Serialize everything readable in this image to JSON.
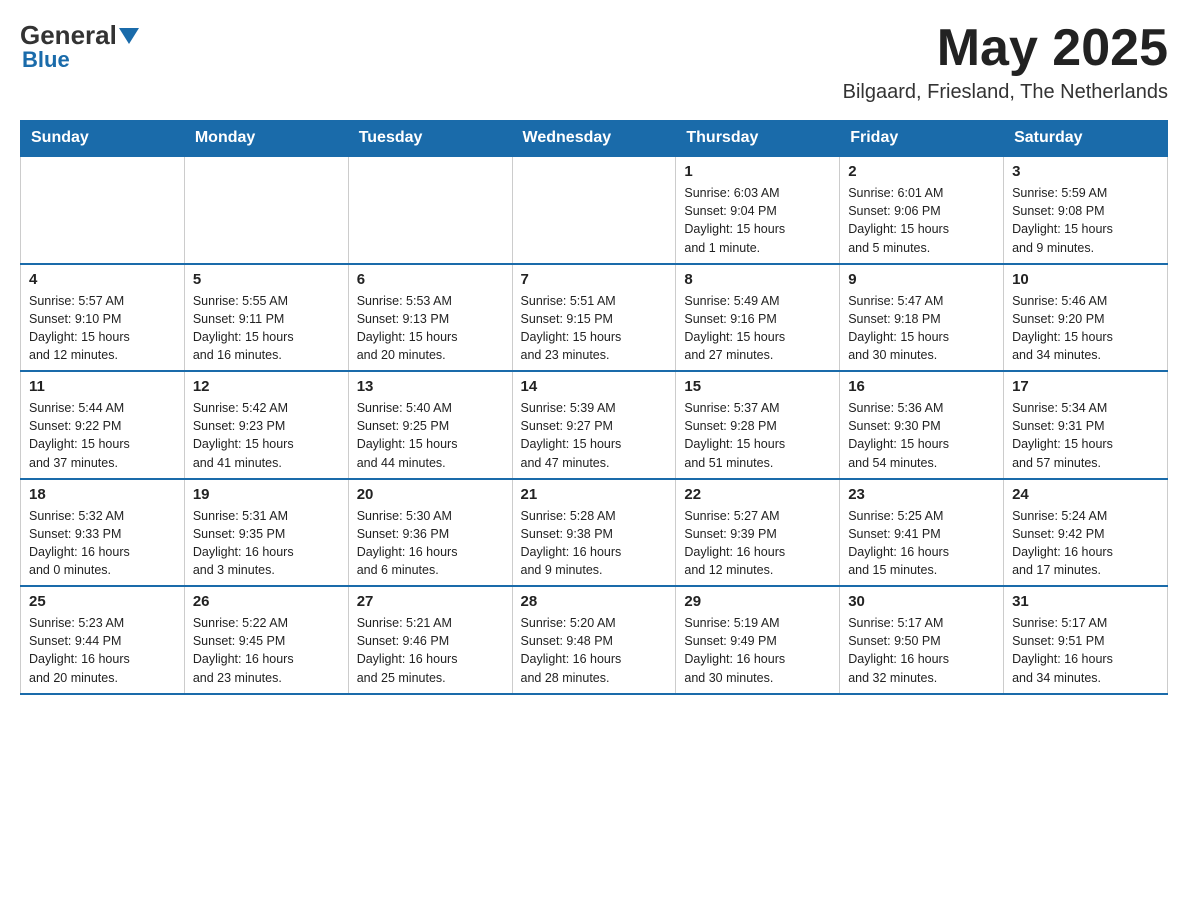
{
  "header": {
    "logo_general": "General",
    "logo_blue": "Blue",
    "month_title": "May 2025",
    "location": "Bilgaard, Friesland, The Netherlands"
  },
  "weekdays": [
    "Sunday",
    "Monday",
    "Tuesday",
    "Wednesday",
    "Thursday",
    "Friday",
    "Saturday"
  ],
  "weeks": [
    [
      {
        "day": "",
        "info": ""
      },
      {
        "day": "",
        "info": ""
      },
      {
        "day": "",
        "info": ""
      },
      {
        "day": "",
        "info": ""
      },
      {
        "day": "1",
        "info": "Sunrise: 6:03 AM\nSunset: 9:04 PM\nDaylight: 15 hours\nand 1 minute."
      },
      {
        "day": "2",
        "info": "Sunrise: 6:01 AM\nSunset: 9:06 PM\nDaylight: 15 hours\nand 5 minutes."
      },
      {
        "day": "3",
        "info": "Sunrise: 5:59 AM\nSunset: 9:08 PM\nDaylight: 15 hours\nand 9 minutes."
      }
    ],
    [
      {
        "day": "4",
        "info": "Sunrise: 5:57 AM\nSunset: 9:10 PM\nDaylight: 15 hours\nand 12 minutes."
      },
      {
        "day": "5",
        "info": "Sunrise: 5:55 AM\nSunset: 9:11 PM\nDaylight: 15 hours\nand 16 minutes."
      },
      {
        "day": "6",
        "info": "Sunrise: 5:53 AM\nSunset: 9:13 PM\nDaylight: 15 hours\nand 20 minutes."
      },
      {
        "day": "7",
        "info": "Sunrise: 5:51 AM\nSunset: 9:15 PM\nDaylight: 15 hours\nand 23 minutes."
      },
      {
        "day": "8",
        "info": "Sunrise: 5:49 AM\nSunset: 9:16 PM\nDaylight: 15 hours\nand 27 minutes."
      },
      {
        "day": "9",
        "info": "Sunrise: 5:47 AM\nSunset: 9:18 PM\nDaylight: 15 hours\nand 30 minutes."
      },
      {
        "day": "10",
        "info": "Sunrise: 5:46 AM\nSunset: 9:20 PM\nDaylight: 15 hours\nand 34 minutes."
      }
    ],
    [
      {
        "day": "11",
        "info": "Sunrise: 5:44 AM\nSunset: 9:22 PM\nDaylight: 15 hours\nand 37 minutes."
      },
      {
        "day": "12",
        "info": "Sunrise: 5:42 AM\nSunset: 9:23 PM\nDaylight: 15 hours\nand 41 minutes."
      },
      {
        "day": "13",
        "info": "Sunrise: 5:40 AM\nSunset: 9:25 PM\nDaylight: 15 hours\nand 44 minutes."
      },
      {
        "day": "14",
        "info": "Sunrise: 5:39 AM\nSunset: 9:27 PM\nDaylight: 15 hours\nand 47 minutes."
      },
      {
        "day": "15",
        "info": "Sunrise: 5:37 AM\nSunset: 9:28 PM\nDaylight: 15 hours\nand 51 minutes."
      },
      {
        "day": "16",
        "info": "Sunrise: 5:36 AM\nSunset: 9:30 PM\nDaylight: 15 hours\nand 54 minutes."
      },
      {
        "day": "17",
        "info": "Sunrise: 5:34 AM\nSunset: 9:31 PM\nDaylight: 15 hours\nand 57 minutes."
      }
    ],
    [
      {
        "day": "18",
        "info": "Sunrise: 5:32 AM\nSunset: 9:33 PM\nDaylight: 16 hours\nand 0 minutes."
      },
      {
        "day": "19",
        "info": "Sunrise: 5:31 AM\nSunset: 9:35 PM\nDaylight: 16 hours\nand 3 minutes."
      },
      {
        "day": "20",
        "info": "Sunrise: 5:30 AM\nSunset: 9:36 PM\nDaylight: 16 hours\nand 6 minutes."
      },
      {
        "day": "21",
        "info": "Sunrise: 5:28 AM\nSunset: 9:38 PM\nDaylight: 16 hours\nand 9 minutes."
      },
      {
        "day": "22",
        "info": "Sunrise: 5:27 AM\nSunset: 9:39 PM\nDaylight: 16 hours\nand 12 minutes."
      },
      {
        "day": "23",
        "info": "Sunrise: 5:25 AM\nSunset: 9:41 PM\nDaylight: 16 hours\nand 15 minutes."
      },
      {
        "day": "24",
        "info": "Sunrise: 5:24 AM\nSunset: 9:42 PM\nDaylight: 16 hours\nand 17 minutes."
      }
    ],
    [
      {
        "day": "25",
        "info": "Sunrise: 5:23 AM\nSunset: 9:44 PM\nDaylight: 16 hours\nand 20 minutes."
      },
      {
        "day": "26",
        "info": "Sunrise: 5:22 AM\nSunset: 9:45 PM\nDaylight: 16 hours\nand 23 minutes."
      },
      {
        "day": "27",
        "info": "Sunrise: 5:21 AM\nSunset: 9:46 PM\nDaylight: 16 hours\nand 25 minutes."
      },
      {
        "day": "28",
        "info": "Sunrise: 5:20 AM\nSunset: 9:48 PM\nDaylight: 16 hours\nand 28 minutes."
      },
      {
        "day": "29",
        "info": "Sunrise: 5:19 AM\nSunset: 9:49 PM\nDaylight: 16 hours\nand 30 minutes."
      },
      {
        "day": "30",
        "info": "Sunrise: 5:17 AM\nSunset: 9:50 PM\nDaylight: 16 hours\nand 32 minutes."
      },
      {
        "day": "31",
        "info": "Sunrise: 5:17 AM\nSunset: 9:51 PM\nDaylight: 16 hours\nand 34 minutes."
      }
    ]
  ]
}
